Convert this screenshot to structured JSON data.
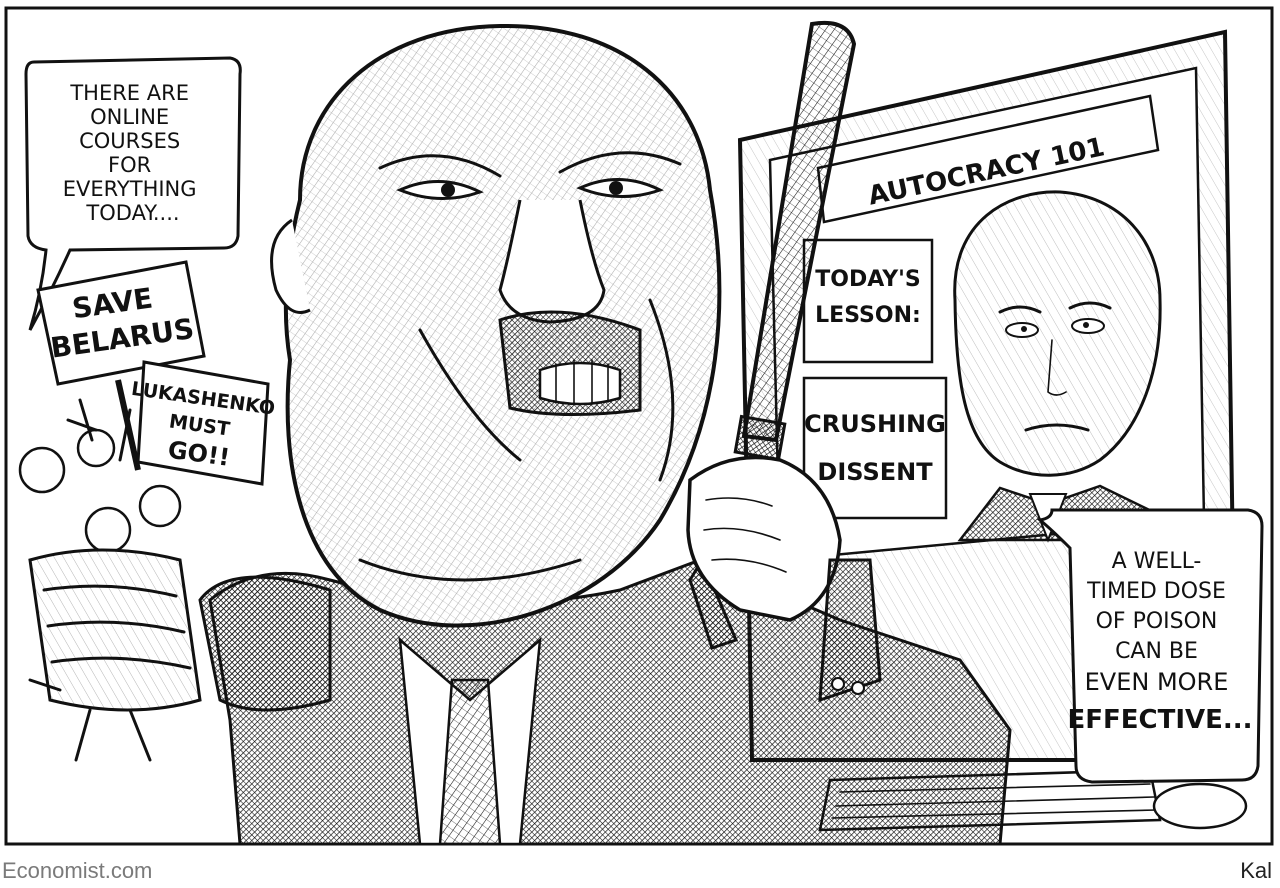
{
  "cartoon": {
    "left_speech_bubble": [
      "THERE ARE",
      "ONLINE",
      "COURSES",
      "FOR",
      "EVERYTHING",
      "TODAY...."
    ],
    "right_speech_bubble": [
      "A WELL-",
      "TIMED DOSE",
      "OF POISON",
      "CAN BE",
      "EVEN MORE",
      "EFFECTIVE..."
    ],
    "protest_sign_1": [
      "SAVE",
      "BELARUS"
    ],
    "protest_sign_2": [
      "LUKASHENKO",
      "MUST",
      "GO!!"
    ],
    "screen_banner": "AUTOCRACY 101",
    "lesson_label": [
      "TODAY'S",
      "LESSON:"
    ],
    "lesson_topic": [
      "CRUSHING",
      "DISSENT"
    ]
  },
  "footer": {
    "source": "Economist.com",
    "artist": "Kal"
  }
}
